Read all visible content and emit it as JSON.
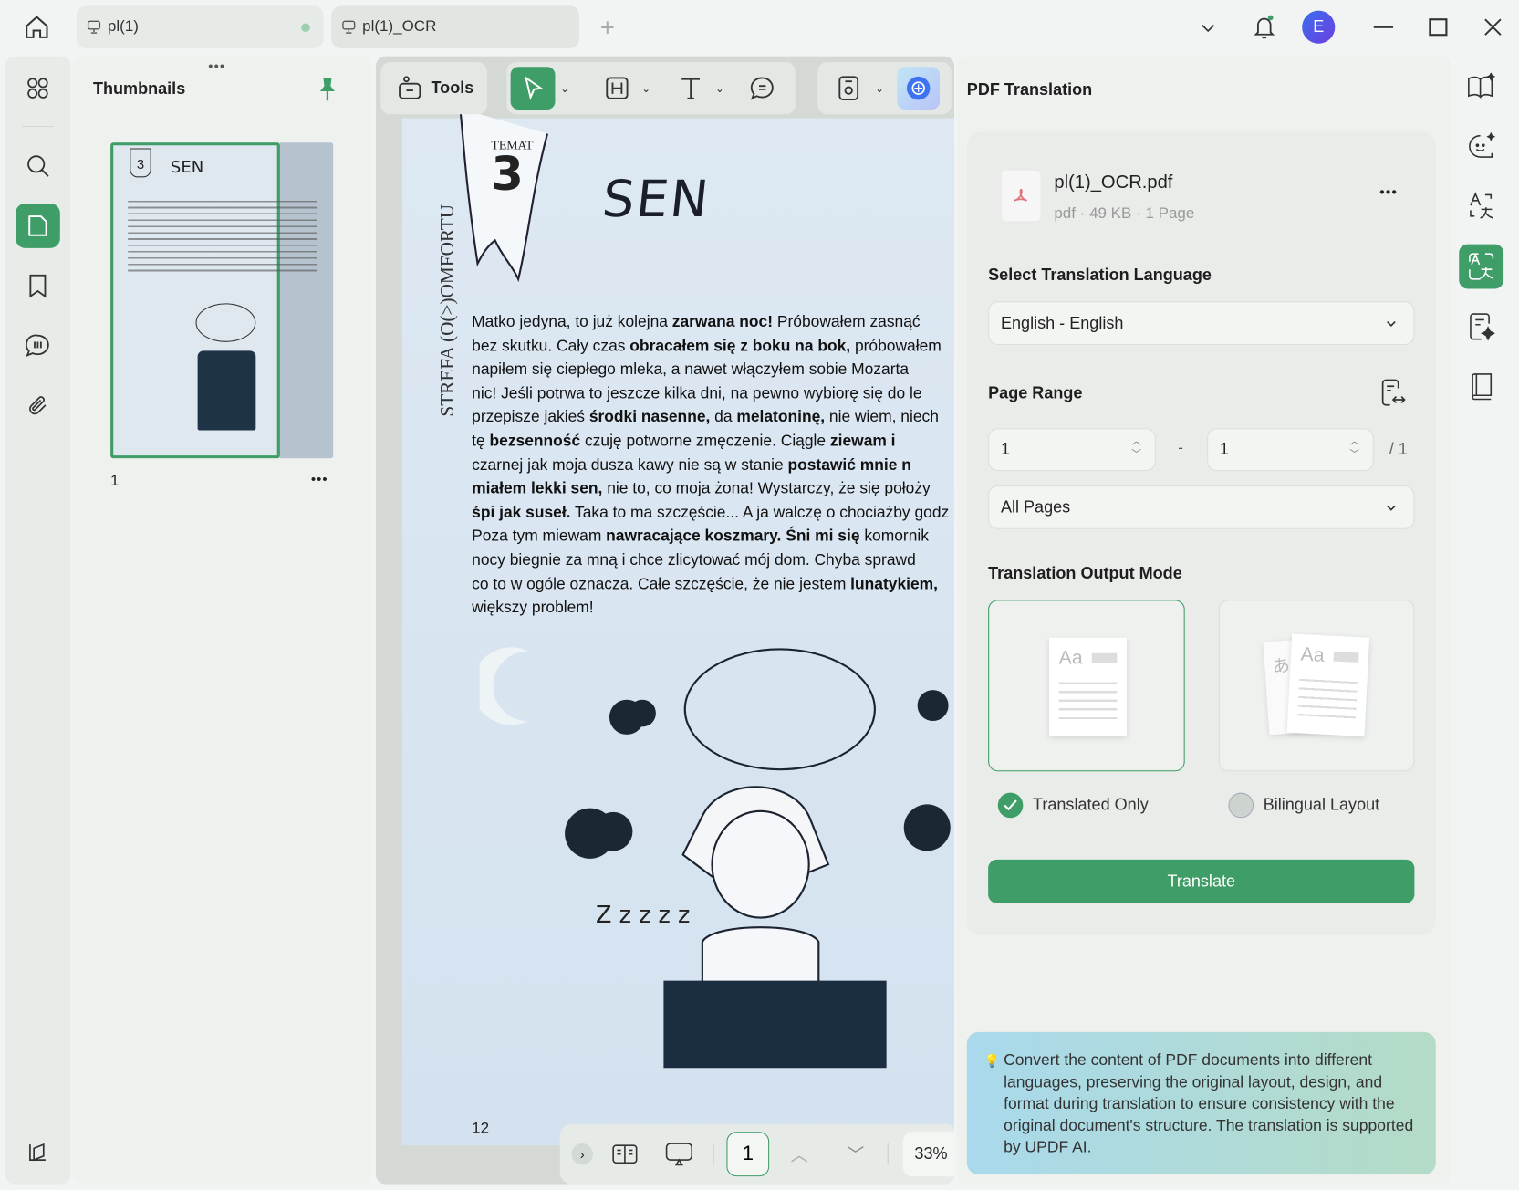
{
  "tabs": [
    {
      "label": "pl(1)",
      "modified": true
    },
    {
      "label": "pl(1)_OCR",
      "active": true
    }
  ],
  "user": {
    "initial": "E",
    "avatar_color": "#4a4de0"
  },
  "thumbnails": {
    "title": "Thumbnails",
    "page_label": "1"
  },
  "toolbar": {
    "tools_label": "Tools"
  },
  "document": {
    "tag_label": "TEMAT",
    "tag_number": "3",
    "title": "SEN",
    "side_title": "STREFA (O(>)OMFORTU",
    "page_number": "12",
    "lines": [
      [
        [
          "Matko jedyna, to już kolejna ",
          0
        ],
        [
          "zarwana noc!",
          1
        ],
        [
          " Próbowałem zasnąć",
          0
        ]
      ],
      [
        [
          "bez skutku. Cały czas ",
          0
        ],
        [
          "obracałem się z boku na bok,",
          1
        ],
        [
          " próbowałem",
          0
        ]
      ],
      [
        [
          "napiłem się ciepłego mleka, a nawet włączyłem sobie Mozarta",
          0
        ]
      ],
      [
        [
          "nic! Jeśli potrwa to jeszcze kilka dni, na pewno wybiorę się do le",
          0
        ]
      ],
      [
        [
          "przepisze jakieś ",
          0
        ],
        [
          "środki nasenne,",
          1
        ],
        [
          " da ",
          0
        ],
        [
          "melatoninę,",
          1
        ],
        [
          " nie wiem, niech",
          0
        ]
      ],
      [
        [
          "tę ",
          0
        ],
        [
          "bezsenność",
          1
        ],
        [
          " czuję potworne zmęczenie. Ciągle ",
          0
        ],
        [
          "ziewam i",
          1
        ]
      ],
      [
        [
          "czarnej jak moja dusza kawy nie są w stanie ",
          0
        ],
        [
          "postawić mnie n",
          1
        ]
      ],
      [
        [
          "miałem lekki sen,",
          1
        ],
        [
          " nie to, co moja żona! Wystarczy, że się położy",
          0
        ]
      ],
      [
        [
          "śpi jak suseł.",
          1
        ],
        [
          " Taka to ma szczęście... A ja walczę o chociażby godz",
          0
        ]
      ],
      [
        [
          "Poza tym miewam ",
          0
        ],
        [
          "nawracające koszmary.",
          1
        ],
        [
          " ",
          0
        ],
        [
          "Śni mi się",
          1
        ],
        [
          " komornik",
          0
        ]
      ],
      [
        [
          "nocy biegnie za mną i chce zlicytować mój dom. Chyba sprawd",
          0
        ]
      ],
      [
        [
          "co to w ogóle oznacza. Całe szczęście, że nie jestem ",
          0
        ],
        [
          "lunatykiem,",
          1
        ]
      ],
      [
        [
          "większy problem!",
          0
        ]
      ]
    ]
  },
  "bottom_bar": {
    "page_input": "1",
    "zoom": "33%"
  },
  "translation": {
    "title": "PDF Translation",
    "file_name": "pl(1)_OCR.pdf",
    "file_meta": "pdf · 49 KB · 1 Page",
    "language_label": "Select Translation Language",
    "language_value": "English - English",
    "page_range_label": "Page Range",
    "range_from": "1",
    "range_dash": "-",
    "range_to": "1",
    "range_total": "/ 1",
    "pages_option": "All Pages",
    "output_mode_label": "Translation Output Mode",
    "modes": [
      {
        "label": "Translated Only",
        "selected": true
      },
      {
        "label": "Bilingual Layout",
        "selected": false
      }
    ],
    "sample_latin": "Aa",
    "sample_cjk": "あ",
    "translate_button": "Translate",
    "info": "Convert the content of PDF documents into different languages, preserving the original layout, design, and format during translation to ensure consistency with the original document's structure. The translation is supported by UPDF AI.",
    "accent": "#3f9e67"
  }
}
